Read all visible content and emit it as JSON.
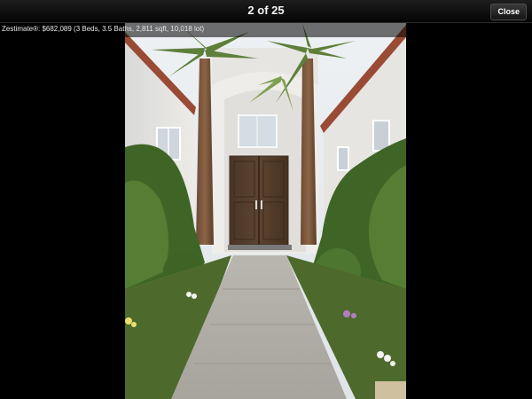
{
  "viewer": {
    "counter": "2 of 25",
    "close_label": "Close"
  },
  "photo": {
    "caption": "Zestimate®: $682,089 (3 Beds, 3.5 Baths, 2,811 sqft, 10,018 lot)"
  }
}
